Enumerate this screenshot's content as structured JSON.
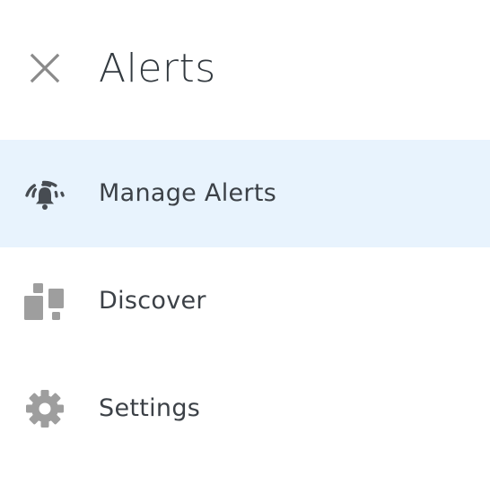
{
  "header": {
    "title": "Alerts",
    "close_icon": "close-icon"
  },
  "menu": {
    "items": [
      {
        "label": "Manage Alerts",
        "icon": "alarm-bell-icon",
        "active": true
      },
      {
        "label": "Discover",
        "icon": "discover-tiles-icon",
        "active": false
      },
      {
        "label": "Settings",
        "icon": "gear-icon",
        "active": false
      }
    ]
  },
  "colors": {
    "active_background": "#e8f3fd",
    "icon_gray": "#9e9e9e",
    "icon_dark": "#474c52",
    "text": "#3c4147"
  }
}
